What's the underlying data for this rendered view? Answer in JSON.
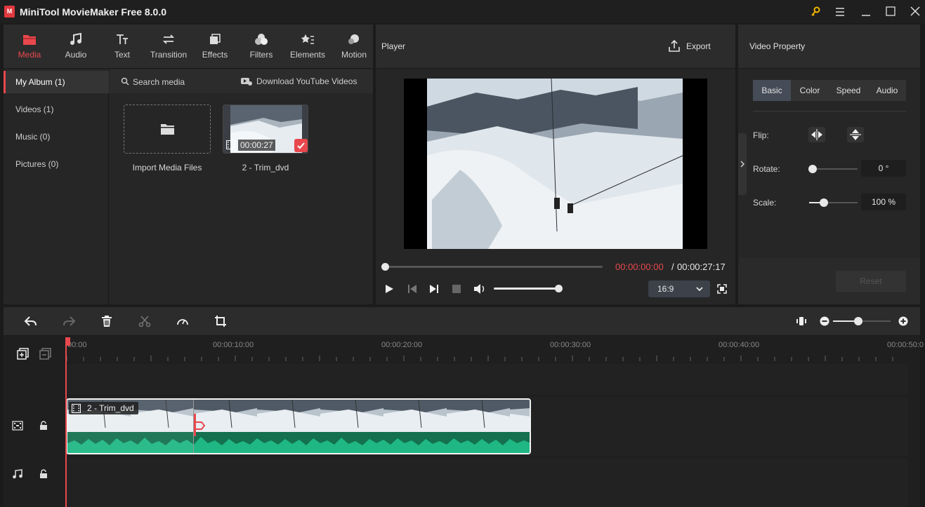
{
  "app": {
    "title": "MiniTool MovieMaker Free 8.0.0",
    "logo": "M"
  },
  "toolbar": {
    "tabs": [
      {
        "label": "Media",
        "icon": "media-folder-icon",
        "active": true
      },
      {
        "label": "Audio",
        "icon": "music-note-icon"
      },
      {
        "label": "Text",
        "icon": "text-icon"
      },
      {
        "label": "Transition",
        "icon": "transition-arrows-icon"
      },
      {
        "label": "Effects",
        "icon": "effects-icon"
      },
      {
        "label": "Filters",
        "icon": "filters-icon"
      },
      {
        "label": "Elements",
        "icon": "elements-icon"
      },
      {
        "label": "Motion",
        "icon": "motion-icon"
      }
    ]
  },
  "sidebar": {
    "items": [
      {
        "label": "My Album (1)",
        "active": true
      },
      {
        "label": "Videos (1)"
      },
      {
        "label": "Music (0)"
      },
      {
        "label": "Pictures (0)"
      }
    ]
  },
  "media": {
    "search_placeholder": "Search media",
    "download_label": "Download YouTube Videos",
    "import_label": "Import Media Files",
    "item": {
      "name": "2 - Trim_dvd",
      "duration": "00:00:27"
    }
  },
  "player": {
    "title": "Player",
    "export_label": "Export",
    "current_time": "00:00:00:00",
    "separator": "/",
    "total_time": "00:00:27:17",
    "aspect": "16:9",
    "progress": 0,
    "volume": 1
  },
  "property": {
    "title": "Video Property",
    "tabs": [
      "Basic",
      "Color",
      "Speed",
      "Audio"
    ],
    "active_tab": "Basic",
    "flip_label": "Flip:",
    "rotate_label": "Rotate:",
    "rotate_value": "0 °",
    "scale_label": "Scale:",
    "scale_value": "100 %",
    "reset_label": "Reset"
  },
  "timeline": {
    "ruler": [
      "00:00",
      "00:00:10:00",
      "00:00:20:00",
      "00:00:30:00",
      "00:00:40:00",
      "00:00:50:0"
    ],
    "clip_name": "2 - Trim_dvd"
  },
  "colors": {
    "accent": "#e8484d",
    "audio_wave": "#1fb783",
    "panel": "#262626"
  }
}
